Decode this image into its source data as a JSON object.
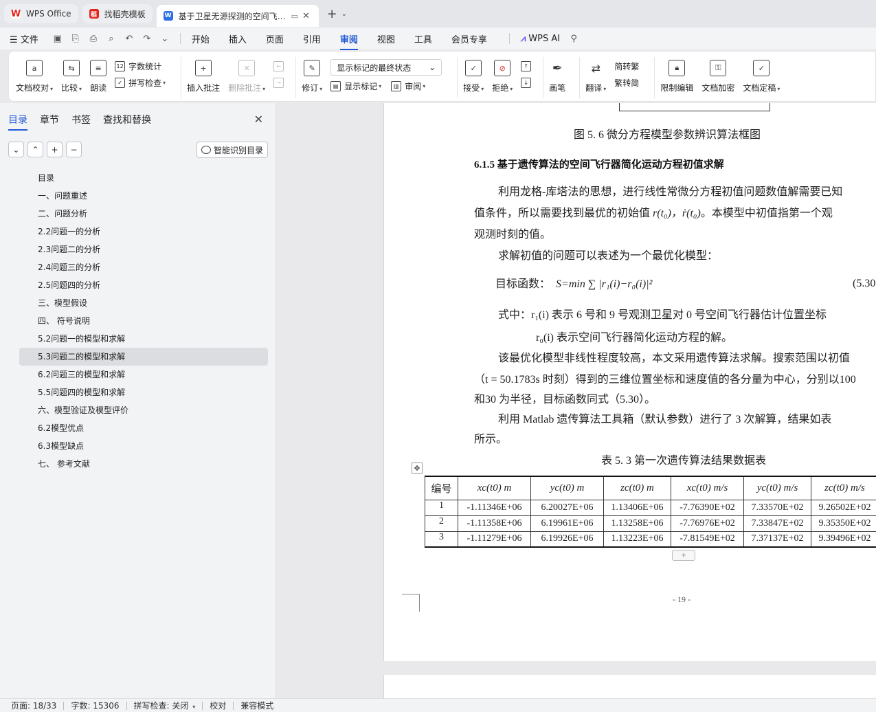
{
  "tabs": [
    {
      "label": "WPS Office",
      "active": false,
      "icon": "wps-logo-icon"
    },
    {
      "label": "找稻壳模板",
      "active": false,
      "icon": "daoke-icon"
    },
    {
      "label": "基于卫星无源探测的空间飞行器",
      "active": true,
      "icon": "doc-icon"
    }
  ],
  "menu": {
    "file": "文件",
    "items": [
      "开始",
      "插入",
      "页面",
      "引用",
      "审阅",
      "视图",
      "工具",
      "会员专享"
    ],
    "active": "审阅",
    "wps_ai": "WPS AI"
  },
  "ribbon": {
    "proofread": "文档校对",
    "compare": "比较",
    "read_aloud": "朗读",
    "word_count": "字数统计",
    "spell_check": "拼写检查",
    "insert_comment": "插入批注",
    "delete_comment": "删除批注",
    "revise": "修订",
    "display_state": "显示标记的最终状态",
    "show_markup": "显示标记",
    "review": "审阅",
    "accept": "接受",
    "reject": "拒绝",
    "pen": "画笔",
    "translate": "翻译",
    "trad": "简转繁",
    "simp": "繁转简",
    "restrict_edit": "限制编辑",
    "encrypt": "文档加密",
    "finalize": "文档定稿"
  },
  "left_pane": {
    "tabs": [
      "目录",
      "章节",
      "书签",
      "查找和替换"
    ],
    "active_tab": "目录",
    "smart_button": "智能识别目录",
    "toc": [
      "目录",
      "一、问题重述",
      "二、问题分析",
      "2.2问题一的分析",
      "2.3问题二的分析",
      "2.4问题三的分析",
      "2.5问题四的分析",
      "三、模型假设",
      "四、 符号说明",
      "5.2问题一的模型和求解",
      "5.3问题二的模型和求解",
      "6.2问题三的模型和求解",
      "5.5问题四的模型和求解",
      "六、模型验证及模型评价",
      "6.2模型优点",
      "6.3模型缺点",
      "七、 参考文献"
    ],
    "selected": "5.3问题二的模型和求解"
  },
  "doc": {
    "fig_caption": "图 5. 6   微分方程模型参数辨识算法框图",
    "section": "6.1.5 基于遗传算法的空间飞行器简化运动方程初值求解",
    "p1_l1": "利用龙格-库塔法的思想，进行线性常微分方程初值问题数值解需要已知",
    "p1_l2a": "值条件，所以需要找到最优的初始值",
    "p1_l2b": "r(t₀)，ṙ(t₀)",
    "p1_l2c": "。本模型中初值指第一个观",
    "p1_l3": "观测时刻的值。",
    "p2": "求解初值的问题可以表述为一个最优化模型：",
    "objective_label": "目标函数：",
    "objective_formula": "S=min ∑ |r₁(i)−r₀(i)|²",
    "eq_number": "(5.30",
    "where_l1": "式中：r₁(i) 表示 6 号和 9 号观测卫星对 0 号空间飞行器估计位置坐标",
    "where_l2": "r₀(i) 表示空间飞行器简化运动方程的解。",
    "p3_l1": "该最优化模型非线性程度较高，本文采用遗传算法求解。搜索范围以初值",
    "p3_l2": "（t = 50.1783s 时刻）得到的三维位置坐标和速度值的各分量为中心，分别以100",
    "p3_l3": "和30 为半径，目标函数同式（5.30）。",
    "p4_l1": "利用  Matlab 遗传算法工具箱（默认参数）进行了  3 次解算，结果如表",
    "p4_l2": "所示。",
    "table_caption": "表  5. 3  第一次遗传算法结果数据表",
    "table_headers": [
      "编号",
      "xc(t0) m",
      "yc(t0) m",
      "zc(t0) m",
      "xc(t0) m/s",
      "yc(t0) m/s",
      "zc(t0) m/s"
    ],
    "table_rows": [
      [
        "1",
        "-1.11346E+06",
        "6.20027E+06",
        "1.13406E+06",
        "-7.76390E+02",
        "7.33570E+02",
        "9.26502E+02"
      ],
      [
        "2",
        "-1.11358E+06",
        "6.19961E+06",
        "1.13258E+06",
        "-7.76976E+02",
        "7.33847E+02",
        "9.35350E+02"
      ],
      [
        "3",
        "-1.11279E+06",
        "6.19926E+06",
        "1.13223E+06",
        "-7.81549E+02",
        "7.37137E+02",
        "9.39496E+02"
      ]
    ],
    "page_number": "- 19 -"
  },
  "status": {
    "page": "页面: 18/33",
    "words": "字数: 15306",
    "spell": "拼写检查: 关闭",
    "proof": "校对",
    "compat": "兼容模式"
  }
}
